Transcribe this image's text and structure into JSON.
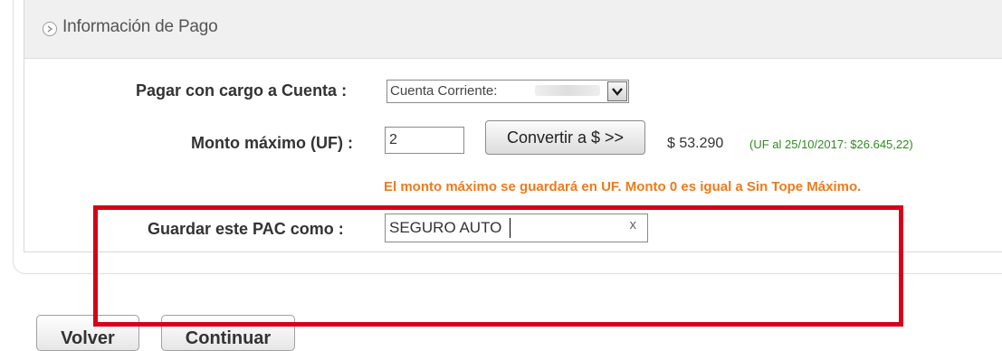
{
  "section": {
    "title": "Información de Pago"
  },
  "account": {
    "label": "Pagar con cargo a Cuenta :",
    "selected": "Cuenta Corriente:"
  },
  "amount": {
    "label": "Monto máximo (UF) :",
    "value": "2",
    "convert_button": "Convertir a $ >>",
    "converted": "$ 53.290",
    "uf_note": "(UF al 25/10/2017: $26.645,22)"
  },
  "warning": "El monto máximo se guardará en UF. Monto 0 es igual a Sin Tope Máximo.",
  "save_as": {
    "label": "Guardar este PAC como :",
    "value": "SEGURO AUTO",
    "clear": "x"
  },
  "footer": {
    "back": "Volver",
    "continue": "Continuar"
  },
  "colors": {
    "warning": "#f07a1a",
    "uf_note": "#2e8b1e",
    "highlight": "#d6001c"
  }
}
